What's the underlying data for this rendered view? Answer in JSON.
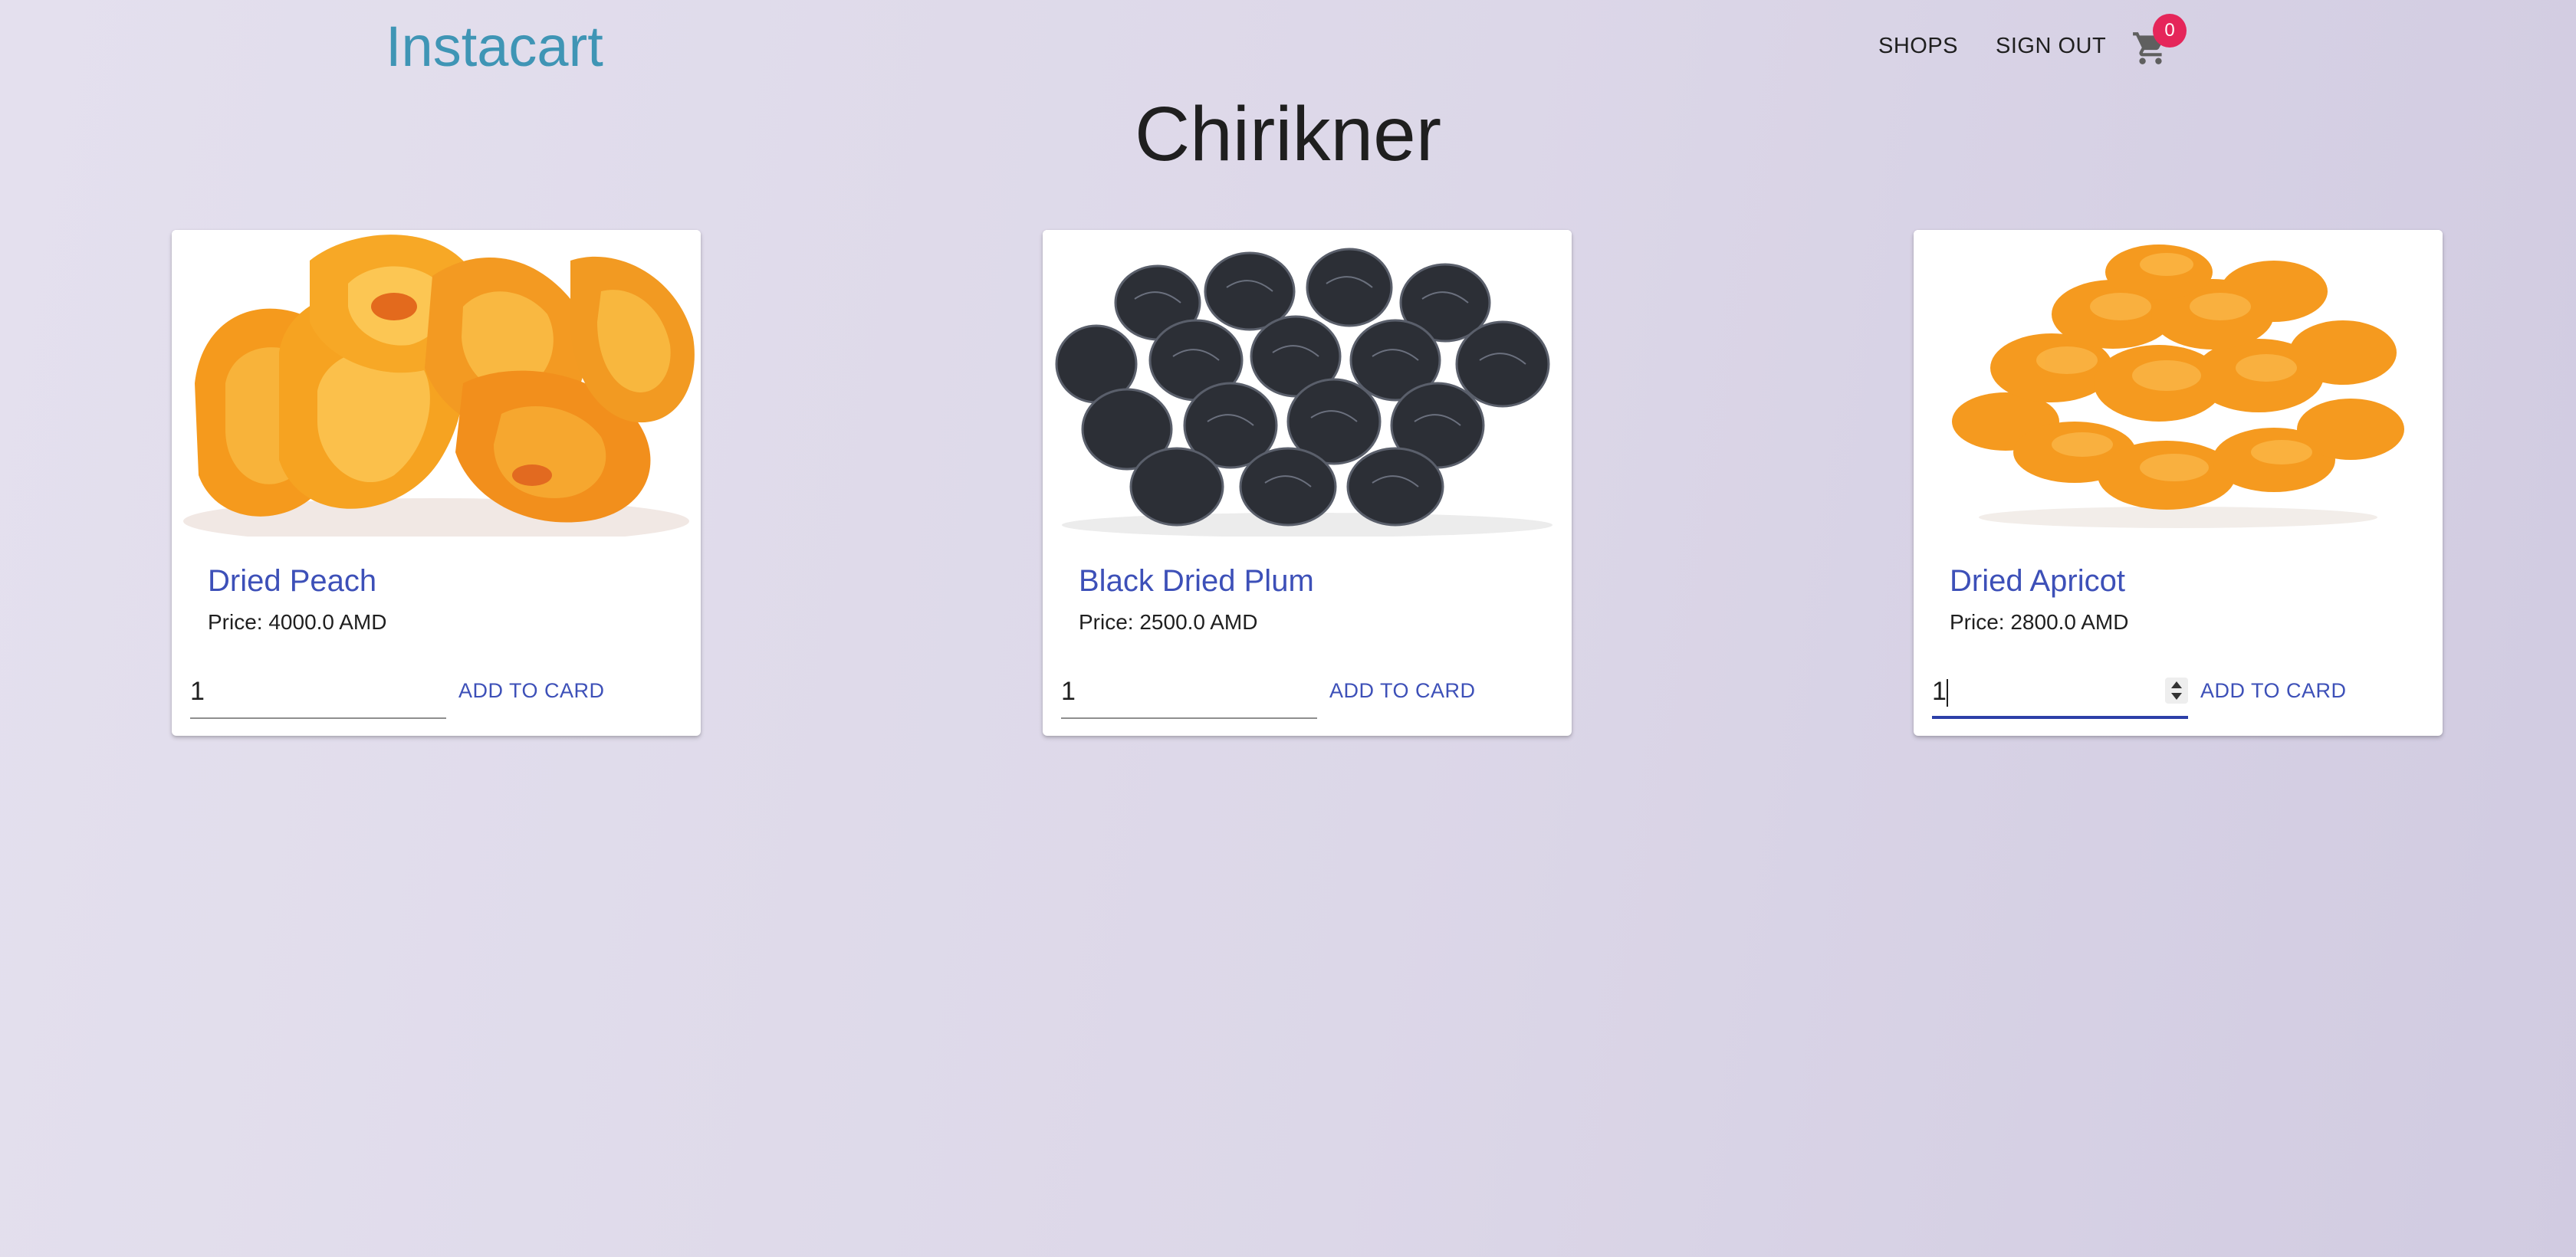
{
  "header": {
    "brand": "Instacart",
    "nav": {
      "shops_label": "SHOPS",
      "signout_label": "SIGN OUT"
    },
    "cart": {
      "icon": "shopping-cart-icon",
      "count": "0",
      "badge_color": "#e5265a"
    }
  },
  "page": {
    "title": "Chirikner"
  },
  "products": [
    {
      "name": "Dried Peach",
      "price": "Price: 4000.0 AMD",
      "quantity": "1",
      "button_label": "ADD TO CARD",
      "image": "dried-peach-image"
    },
    {
      "name": "Black Dried Plum",
      "price": "Price: 2500.0 AMD",
      "quantity": "1",
      "button_label": "ADD TO CARD",
      "image": "black-dried-plum-image"
    },
    {
      "name": "Dried Apricot",
      "price": "Price: 2800.0 AMD",
      "quantity": "1",
      "button_label": "ADD TO CARD",
      "image": "dried-apricot-image"
    }
  ],
  "colors": {
    "brand": "#3f95b5",
    "accent": "#3d50b8",
    "focus_underline": "#2c3fa8"
  }
}
